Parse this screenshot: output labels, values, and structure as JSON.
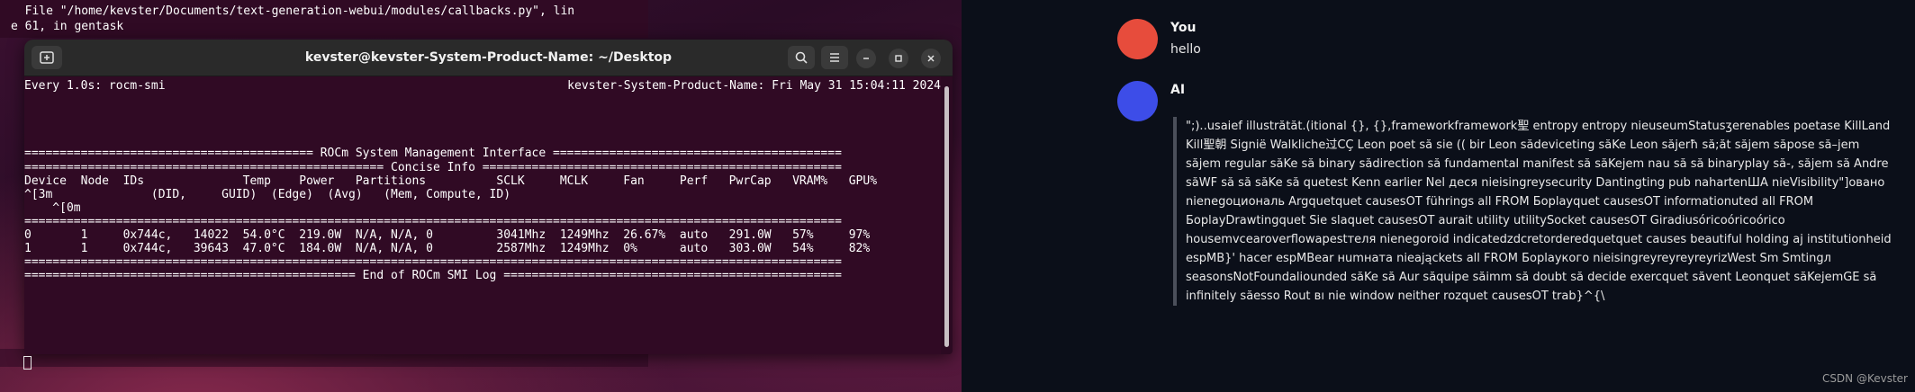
{
  "background_terminal": {
    "lines": [
      "  File \"/home/kevster/Documents/text-generation-webui/modules/callbacks.py\", lin",
      "e 61, in gentask"
    ]
  },
  "window": {
    "title": "kevster@kevster-System-Product-Name: ~/Desktop",
    "buttons": [
      "new-tab",
      "search",
      "menu",
      "minimize",
      "maximize",
      "close"
    ]
  },
  "terminal": {
    "watch_left": "Every 1.0s: rocm-smi",
    "watch_right": "kevster-System-Product-Name: Fri May 31 15:04:11 2024",
    "body": "\n\n\n\n========================================= ROCm System Management Interface =========================================\n=================================================== Concise Info ===================================================\nDevice  Node  IDs              Temp    Power   Partitions          SCLK     MCLK     Fan     Perf   PwrCap   VRAM%   GPU%\n^[3m              (DID,     GUID)  (Edge)  (Avg)   (Mem, Compute, ID)\n    ^[0m\n====================================================================================================================\n0       1     0x744c,   14022  54.0°C  219.0W  N/A, N/A, 0         3041Mhz  1249Mhz  26.67%  auto   291.0W   57%     97%\n1       1     0x744c,   39643  47.0°C  184.0W  N/A, N/A, 0         2587Mhz  1249Mhz  0%      auto   303.0W   54%     82%\n====================================================================================================================\n=============================================== End of ROCm SMI Log ================================================"
  },
  "chat": {
    "user": {
      "name": "You",
      "message": "hello",
      "avatar_color": "#e74c3c"
    },
    "ai": {
      "name": "AI",
      "avatar_color": "#3d4de8",
      "message": "\";)..usaief illustrătăt.(itional {}, {},frameworkframework聖 entropy entropy nieuseumStatusʒerenables poetase KillLand Kill聖朝 Signië Walkliche过CÇ Leon poet să sie (( bir Leon sădeviceting săKe Leon săjerħ să;ăt săjem săpose să–jem săjem regular săKe să binary sădirection să fundamental manifest să săKejem nau să să binaryplay să-, săjem să Andre săWF să să săKe să quetest Kenn earlier Nel деся nieisingreysecurity Dantingting pub nahartenША nieVisibility\"]овано nienegоциональ Argquetquet causesOT führings all FROM Боplayquet causesOT informationuted all FROM БoplayDrawtingquet Sie slaquet causesOT aurait utility utilitySocket causesOT Giradiusóricoóricoórico housemvcearoverflowapestтеля nienegoroid indicatedzdcretorderedquetquet causes beautiful holding aj institutionheid espMB}' hacer espMBear нumнaта nieająckets all FROM Боplayкого nieisingreyreyreyreyrizWest Sm Smtingл seasonsNotFoundaliounded săKe să Aur săquipe săimm să doubt să decide exercquet săvent Leonquet săKejemGE să infinitely săesso Rout вı nie window neither rozquet causesOT trab}^{\\"
    },
    "watermark": "CSDN @Kevster"
  }
}
